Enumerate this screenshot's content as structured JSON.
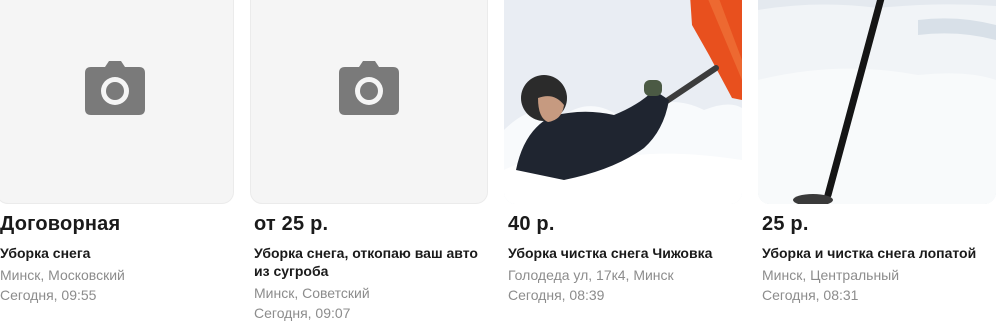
{
  "listings": [
    {
      "price": "Договорная",
      "title": "Уборка снега",
      "location": "Минск, Московский",
      "date": "Сегодня, 09:55",
      "photo": "camera-placeholder-icon"
    },
    {
      "price": "от 25 р.",
      "title": "Уборка снега, откопаю ваш авто из сугроба",
      "location": "Минск, Советский",
      "date": "Сегодня, 09:07",
      "photo": "camera-placeholder-icon"
    },
    {
      "price": "40 р.",
      "title": "Уборка чистка снега Чижовка",
      "location": "Голодеда ул, 17к4, Минск",
      "date": "Сегодня, 08:39",
      "photo": "photo"
    },
    {
      "price": "25 р.",
      "title": "Уборка и чистка снега лопатой",
      "location": "Минск, Центральный",
      "date": "Сегодня, 08:31",
      "photo": "photo"
    }
  ]
}
